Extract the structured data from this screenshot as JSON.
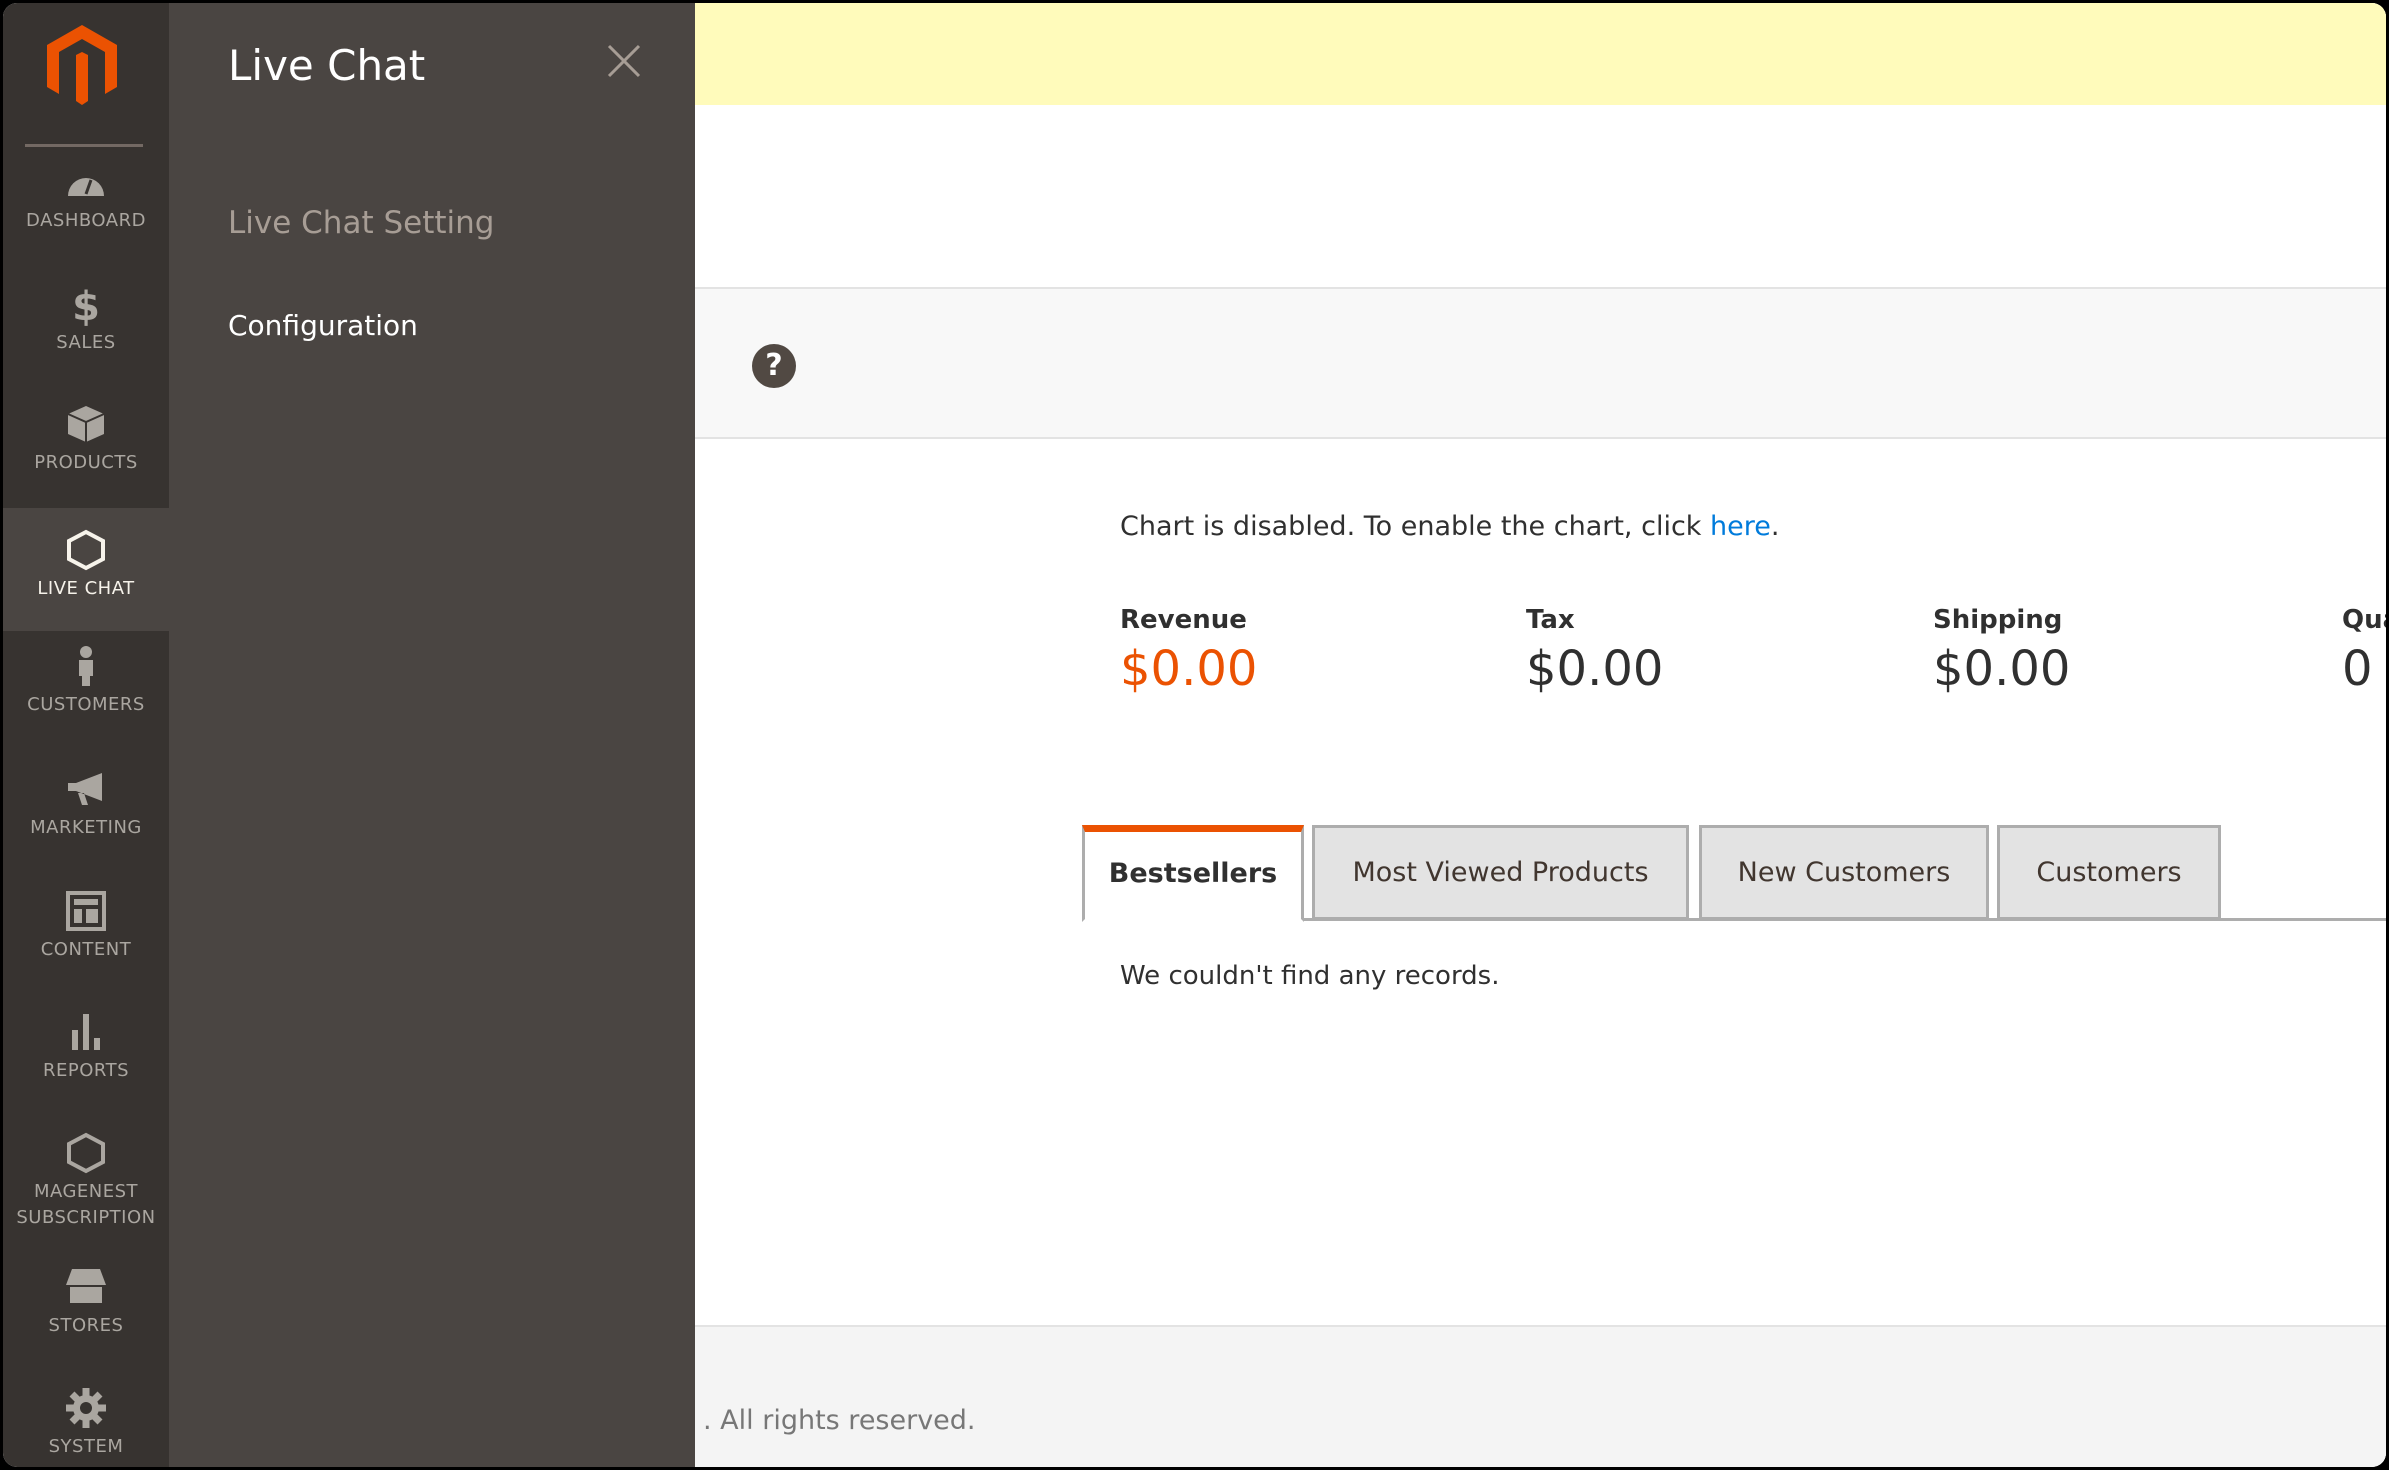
{
  "colors": {
    "brand": "#eb5202",
    "link": "#007bdb",
    "sidebar": "#373330",
    "flyout": "#4a4542",
    "notice": "#fffbbb"
  },
  "sidebar": {
    "items": [
      {
        "label": "DASHBOARD",
        "icon": "dashboard-icon"
      },
      {
        "label": "SALES",
        "icon": "dollar-icon"
      },
      {
        "label": "PRODUCTS",
        "icon": "box-icon"
      },
      {
        "label": "LIVE CHAT",
        "icon": "hexagon-icon",
        "active": true
      },
      {
        "label": "CUSTOMERS",
        "icon": "person-icon"
      },
      {
        "label": "MARKETING",
        "icon": "megaphone-icon"
      },
      {
        "label": "CONTENT",
        "icon": "layout-icon"
      },
      {
        "label": "REPORTS",
        "icon": "bar-chart-icon"
      },
      {
        "label": "MAGENEST\nSUBSCRIPTION",
        "icon": "hexagon-icon"
      },
      {
        "label": "STORES",
        "icon": "store-icon"
      },
      {
        "label": "SYSTEM",
        "icon": "gear-icon"
      }
    ]
  },
  "flyout": {
    "title": "Live Chat",
    "section": "Live Chat Setting",
    "links": [
      "Configuration"
    ]
  },
  "dashboard": {
    "chart_message": "Chart is disabled. To enable the chart, click ",
    "chart_link": "here",
    "chart_end": ".",
    "totals": [
      {
        "label": "Revenue",
        "value": "$0.00"
      },
      {
        "label": "Tax",
        "value": "$0.00"
      },
      {
        "label": "Shipping",
        "value": "$0.00"
      },
      {
        "label": "Qua",
        "value": "0"
      }
    ],
    "tabs": [
      "Bestsellers",
      "Most Viewed Products",
      "New Customers",
      "Customers"
    ],
    "active_tab": "Bestsellers",
    "empty_message": "We couldn't find any records."
  },
  "footer": {
    "copyright": ". All rights reserved."
  }
}
